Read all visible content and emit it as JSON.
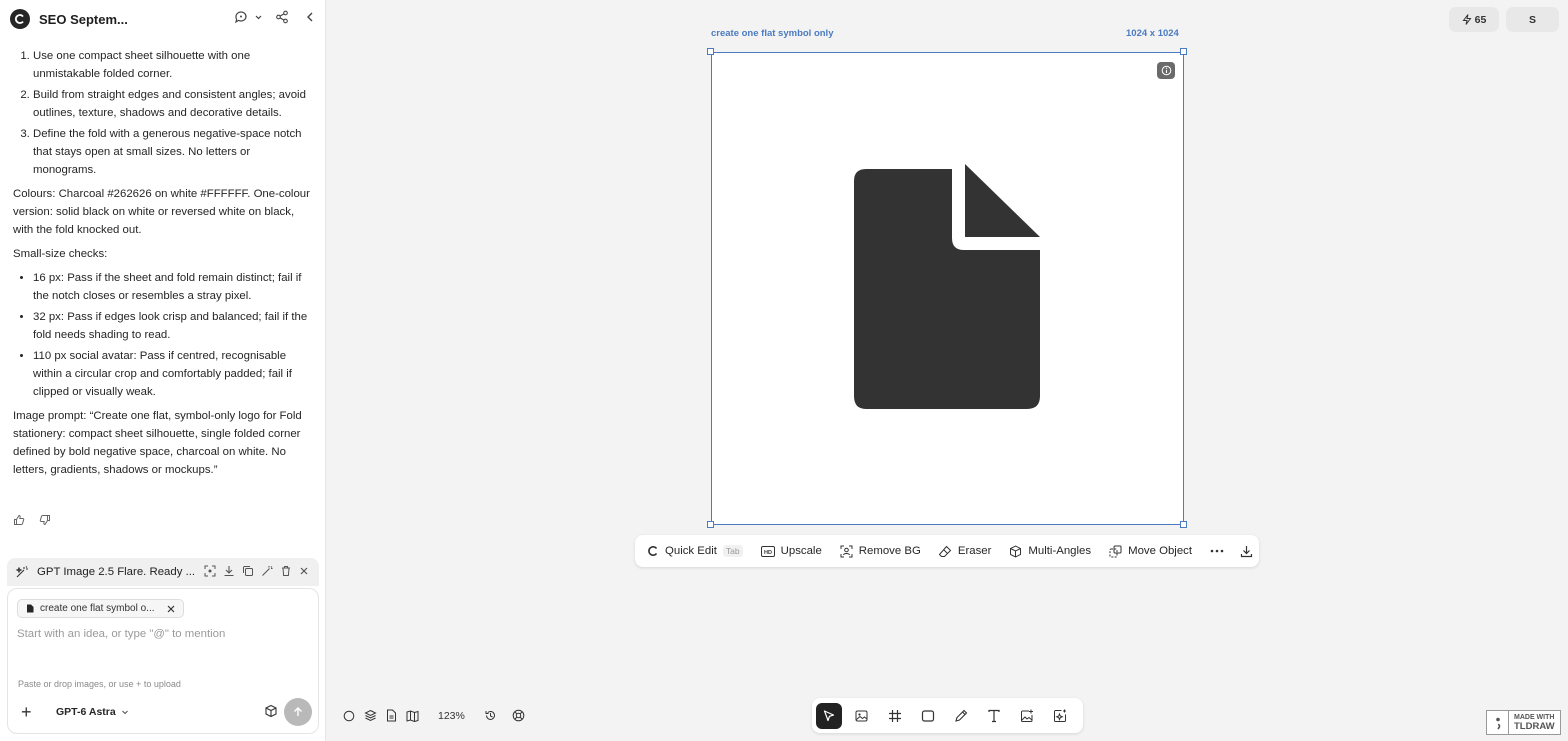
{
  "header": {
    "title": "SEO Septem..."
  },
  "message": {
    "ordered": [
      "Use one compact sheet silhouette with one unmistakable folded corner.",
      "Build from straight edges and consistent angles; avoid outlines, texture, shadows and decorative details.",
      "Define the fold with a generous negative-space notch that stays open at small sizes. No letters or monograms."
    ],
    "colours": "Colours: Charcoal #262626 on white #FFFFFF. One-colour version: solid black on white or reversed white on black, with the fold knocked out.",
    "checks_title": "Small-size checks:",
    "checks": [
      "16 px: Pass if the sheet and fold remain distinct; fail if the notch closes or resembles a stray pixel.",
      "32 px: Pass if edges look crisp and balanced; fail if the fold needs shading to read.",
      "110 px social avatar: Pass if centred, recognisable within a circular crop and comfortably padded; fail if clipped or visually weak."
    ],
    "image_prompt": "Image prompt: “Create one flat, symbol-only logo for Fold stationery: compact sheet silhouette, single folded corner defined by bold negative space, charcoal on white. No letters, gradients, shadows or mockups.”"
  },
  "generation": {
    "status": "GPT Image 2.5 Flare. Ready ..."
  },
  "composer": {
    "chip": "create one flat symbol o...",
    "placeholder": "Start with an idea, or type \"@\" to mention",
    "hint": "Paste or drop images, or use + to upload",
    "model": "GPT-6 Astra"
  },
  "topright": {
    "credits": "65",
    "avatar": "S"
  },
  "frame": {
    "label": "create one flat symbol only",
    "size": "1024 x 1024"
  },
  "image_toolbar": {
    "quick_edit": "Quick Edit",
    "quick_edit_key": "Tab",
    "upscale": "Upscale",
    "remove_bg": "Remove BG",
    "eraser": "Eraser",
    "multi_angles": "Multi-Angles",
    "move_object": "Move Object"
  },
  "canvas": {
    "zoom": "123%"
  },
  "watermark": {
    "line1": "MADE WITH",
    "line2": "TLDRAW"
  },
  "colors": {
    "charcoal": "#262626",
    "selection": "#4b7bc0"
  }
}
